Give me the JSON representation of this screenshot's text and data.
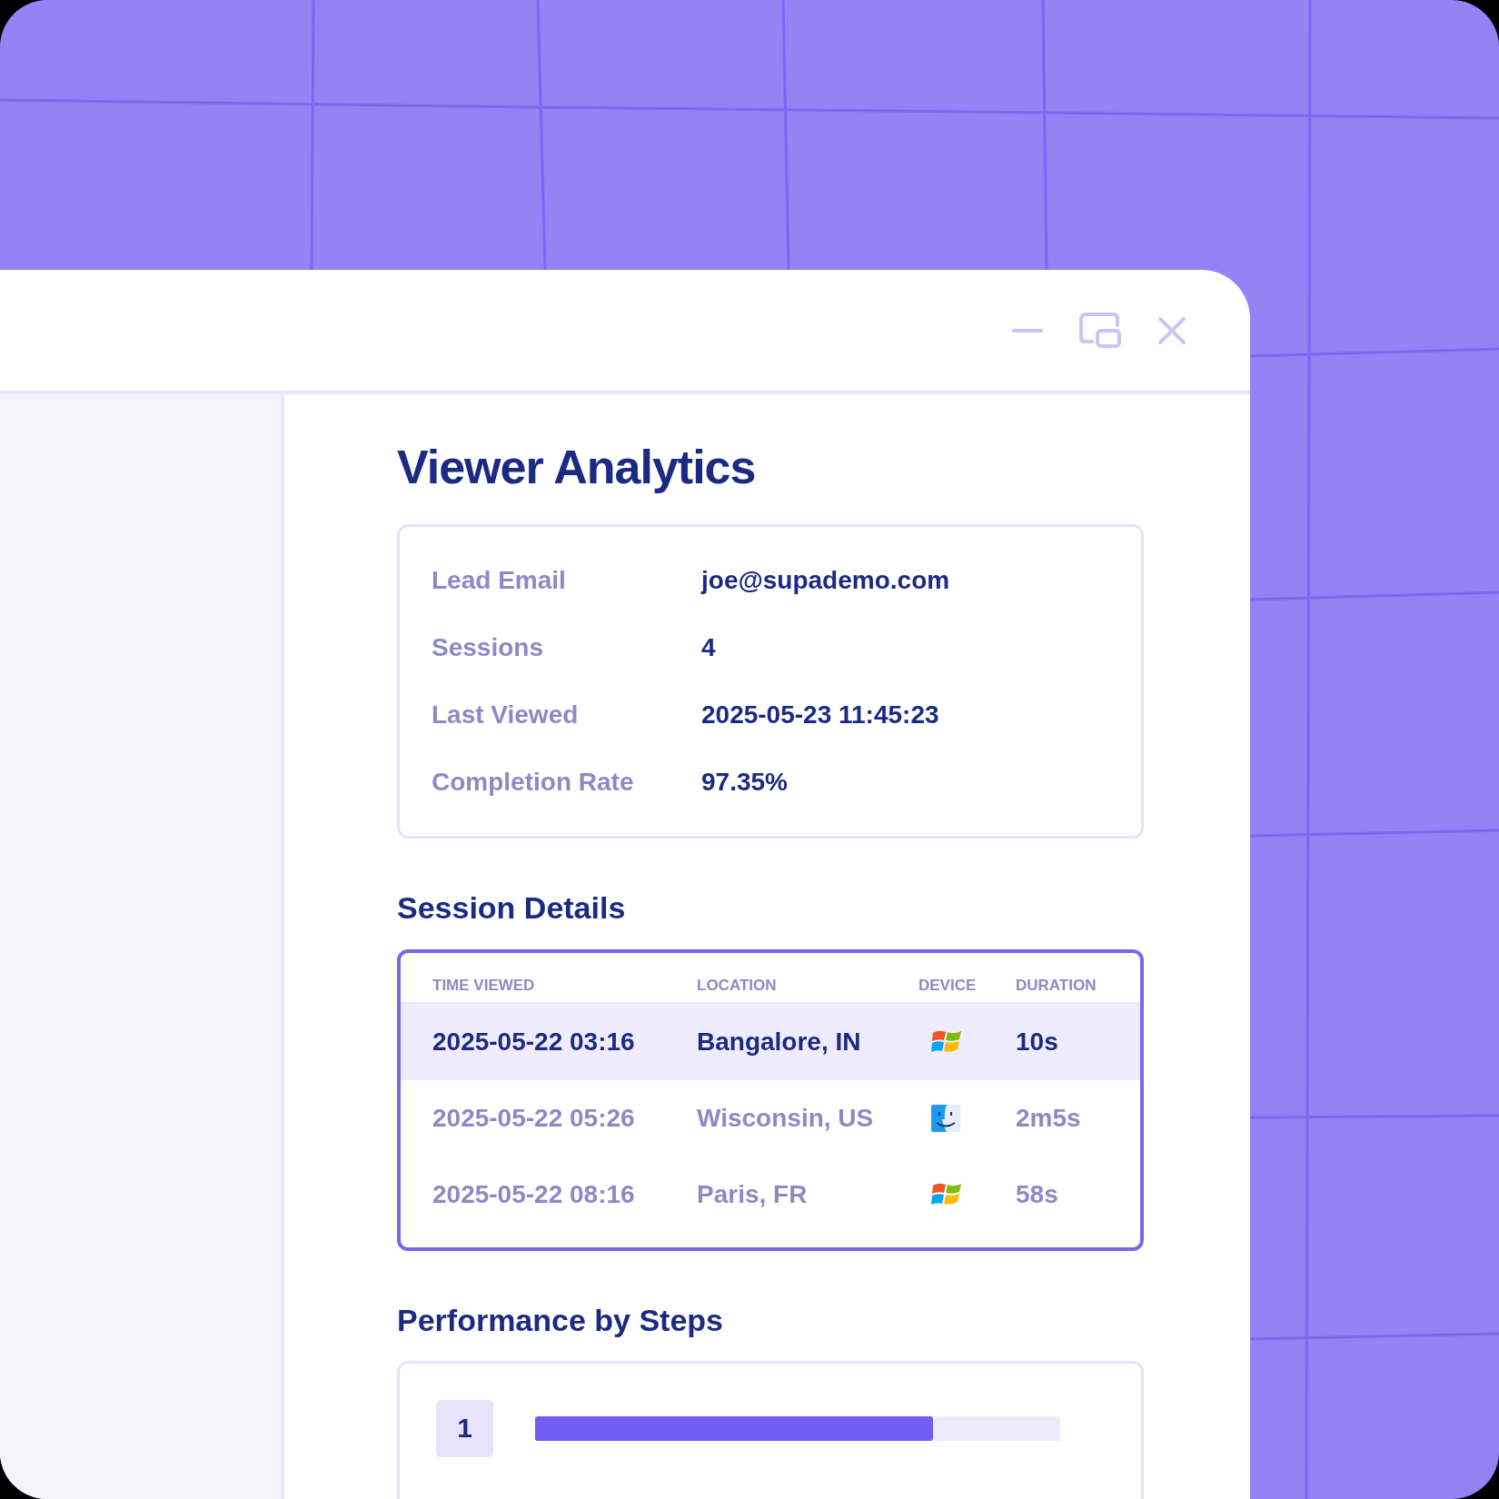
{
  "title": "Viewer Analytics",
  "summary": [
    {
      "label": "Lead Email",
      "value": "joe@supademo.com"
    },
    {
      "label": "Sessions",
      "value": "4"
    },
    {
      "label": "Last Viewed",
      "value": "2025-05-23 11:45:23"
    },
    {
      "label": "Completion Rate",
      "value": "97.35%"
    }
  ],
  "sessions": {
    "heading": "Session Details",
    "columns": [
      "TIME VIEWED",
      "LOCATION",
      "DEVICE",
      "DURATION"
    ],
    "rows": [
      {
        "time": "2025-05-22 03:16",
        "location": "Bangalore, IN",
        "kind": "windows",
        "duration": "10s",
        "selected": true
      },
      {
        "time": "2025-05-22 05:26",
        "location": "Wisconsin, US",
        "kind": "mac",
        "duration": "2m5s",
        "selected": false
      },
      {
        "time": "2025-05-22 08:16",
        "location": "Paris, FR",
        "kind": "windows",
        "duration": "58s",
        "selected": false
      }
    ]
  },
  "performance": {
    "heading": "Performance by Steps",
    "steps": [
      {
        "number": "1",
        "level": 0.757
      }
    ]
  }
}
